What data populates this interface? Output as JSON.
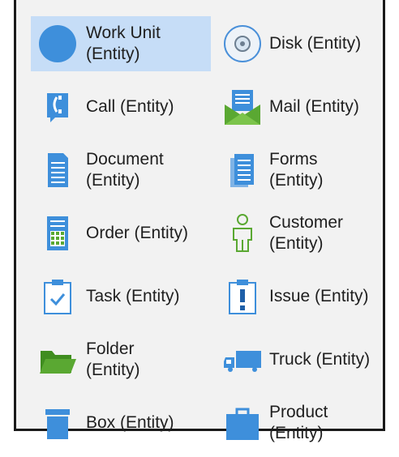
{
  "shapes": [
    {
      "id": "work-unit",
      "label_line1": "Work Unit",
      "label_line2": "(Entity)",
      "icon": "circle-icon",
      "selected": true
    },
    {
      "id": "disk",
      "label_line1": "Disk (Entity)",
      "label_line2": "",
      "icon": "disk-icon",
      "selected": false
    },
    {
      "id": "call",
      "label_line1": "Call (Entity)",
      "label_line2": "",
      "icon": "phone-icon",
      "selected": false
    },
    {
      "id": "mail",
      "label_line1": "Mail (Entity)",
      "label_line2": "",
      "icon": "mail-icon",
      "selected": false
    },
    {
      "id": "document",
      "label_line1": "Document",
      "label_line2": "(Entity)",
      "icon": "document-icon",
      "selected": false
    },
    {
      "id": "forms",
      "label_line1": "Forms",
      "label_line2": "(Entity)",
      "icon": "forms-icon",
      "selected": false
    },
    {
      "id": "order",
      "label_line1": "Order (Entity)",
      "label_line2": "",
      "icon": "order-icon",
      "selected": false
    },
    {
      "id": "customer",
      "label_line1": "Customer",
      "label_line2": "(Entity)",
      "icon": "customer-icon",
      "selected": false
    },
    {
      "id": "task",
      "label_line1": "Task (Entity)",
      "label_line2": "",
      "icon": "task-icon",
      "selected": false
    },
    {
      "id": "issue",
      "label_line1": "Issue (Entity)",
      "label_line2": "",
      "icon": "issue-icon",
      "selected": false
    },
    {
      "id": "folder",
      "label_line1": "Folder",
      "label_line2": "(Entity)",
      "icon": "folder-icon",
      "selected": false
    },
    {
      "id": "truck",
      "label_line1": "Truck (Entity)",
      "label_line2": "",
      "icon": "truck-icon",
      "selected": false
    },
    {
      "id": "box",
      "label_line1": "Box (Entity)",
      "label_line2": "",
      "icon": "box-icon",
      "selected": false
    },
    {
      "id": "product",
      "label_line1": "Product",
      "label_line2": "(Entity)",
      "icon": "product-icon",
      "selected": false
    }
  ],
  "colors": {
    "icon_blue": "#3e8fdb",
    "mail_green": "#5aa832",
    "selection": "#c6ddf7"
  }
}
